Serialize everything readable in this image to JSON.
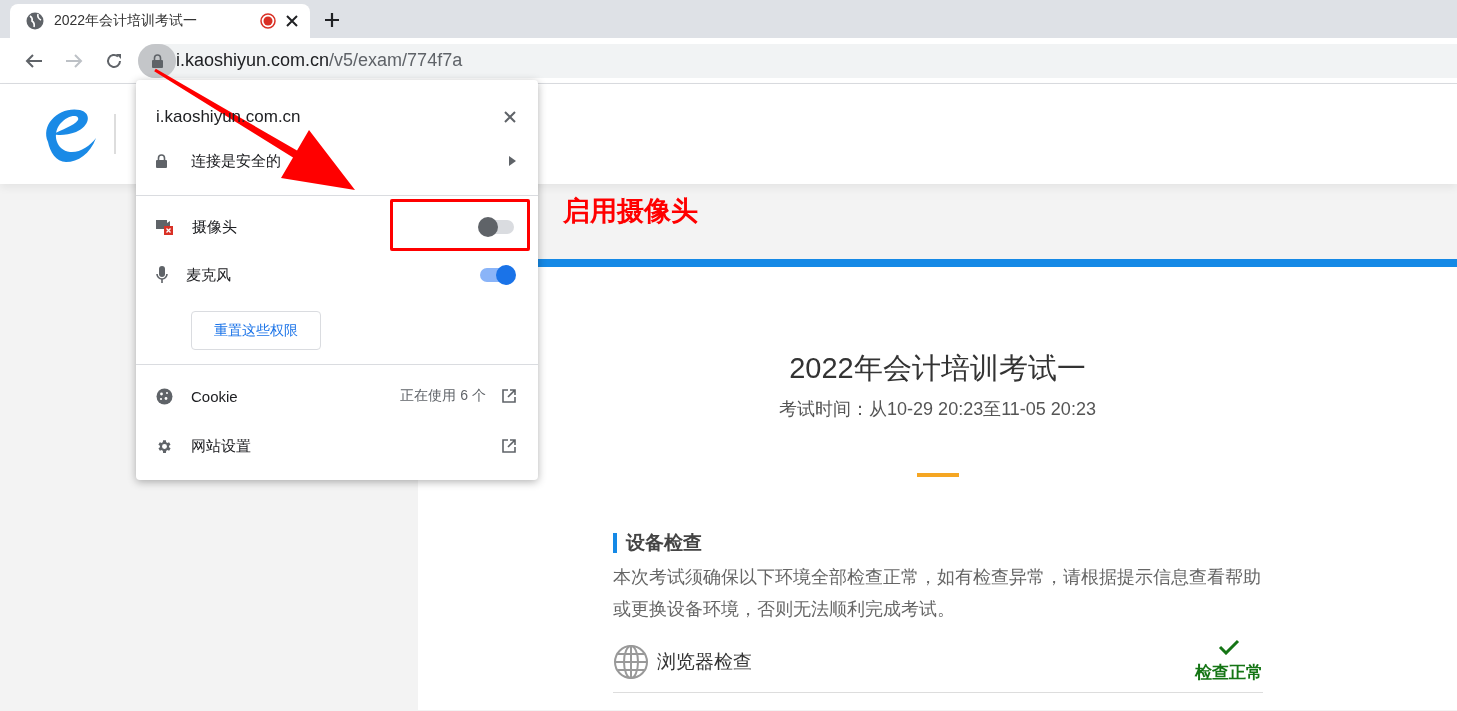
{
  "browser": {
    "tab": {
      "title": "2022年会计培训考试一",
      "recording": true,
      "selected": true
    },
    "address": {
      "host": "i.kaoshiyun.com.cn",
      "path": "/v5/exam/774f7a"
    }
  },
  "site_popup": {
    "host": "i.kaoshiyun.com.cn",
    "connection": "连接是安全的",
    "permissions": [
      {
        "kind": "camera",
        "label": "摄像头",
        "on": false
      },
      {
        "kind": "microphone",
        "label": "麦克风",
        "on": true
      }
    ],
    "reset_button": "重置这些权限",
    "links": [
      {
        "kind": "cookie",
        "label": "Cookie",
        "detail": "正在使用 6 个"
      },
      {
        "kind": "settings",
        "label": "网站设置"
      }
    ]
  },
  "annotation": {
    "text": "启用摄像头"
  },
  "exam": {
    "title": "2022年会计培训考试一",
    "time": "考试时间：从10-29 20:23至11-05 20:23",
    "section": {
      "heading": "设备检查",
      "description": "本次考试须确保以下环境全部检查正常，如有检查异常，请根据提示信息查看帮助或更换设备环境，否则无法顺利完成考试。",
      "checks": [
        {
          "label": "浏览器检查",
          "status": "检查正常",
          "ok": true
        }
      ]
    }
  }
}
